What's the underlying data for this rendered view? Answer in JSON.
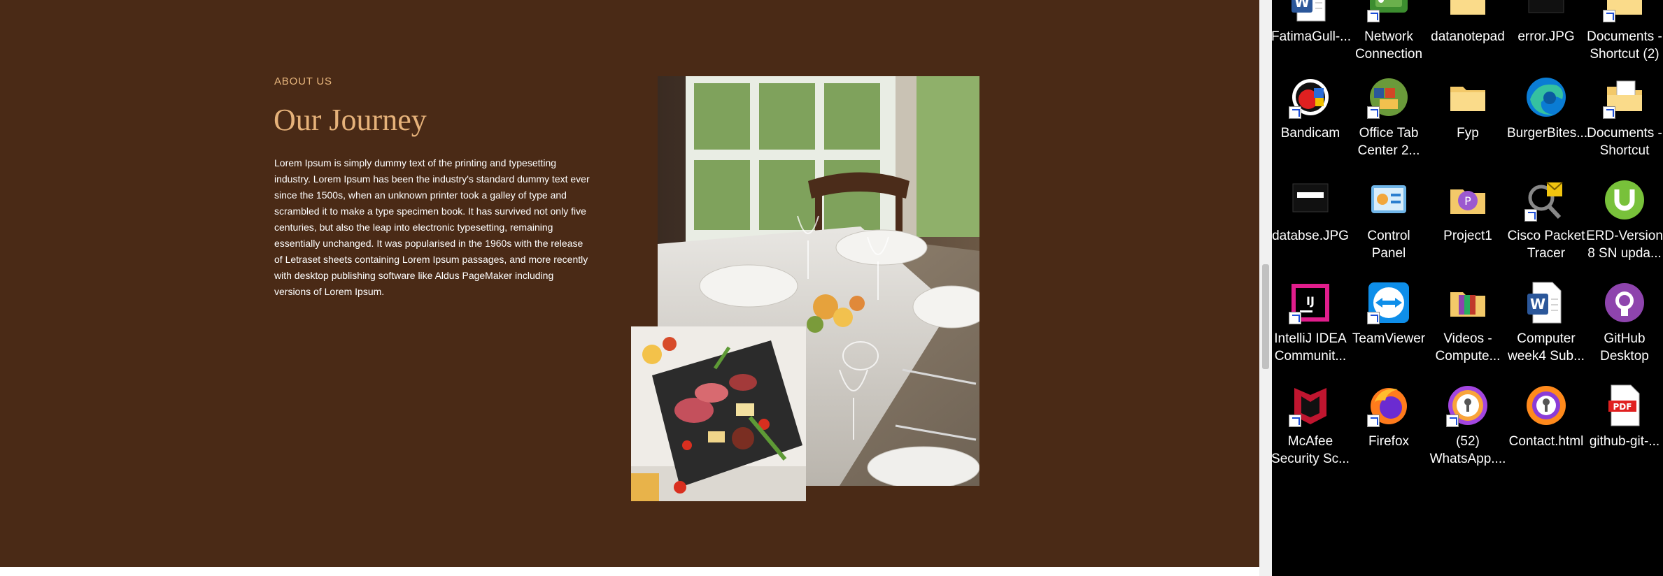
{
  "about": {
    "eyebrow": "ABOUT US",
    "title": "Our Journey",
    "body": "Lorem Ipsum is simply dummy text of the printing and typesetting industry. Lorem Ipsum has been the industry's standard dummy text ever since the 1500s, when an unknown printer took a galley of type and scrambled it to make a type specimen book. It has survived not only five centuries, but also the leap into electronic typesetting, remaining essentially unchanged. It was popularised in the 1960s with the release of Letraset sheets containing Lorem Ipsum passages, and more recently with desktop publishing software like Aldus PageMaker including versions of Lorem Ipsum."
  },
  "colors": {
    "section_bg": "#4a2a16",
    "accent": "#e6b27a"
  },
  "desktop": {
    "icons": [
      {
        "label": "FatimaGull-...",
        "icon": "word-document-icon"
      },
      {
        "label": "Network Connection",
        "icon": "network-connection-icon"
      },
      {
        "label": "datanotepad",
        "icon": "folder-icon"
      },
      {
        "label": "error.JPG",
        "icon": "image-file-icon"
      },
      {
        "label": "Documents - Shortcut (2)",
        "icon": "folder-shortcut-icon"
      },
      {
        "label": "Bandicam",
        "icon": "bandicam-icon"
      },
      {
        "label": "Office Tab Center 2...",
        "icon": "office-tab-icon"
      },
      {
        "label": "Fyp",
        "icon": "folder-icon"
      },
      {
        "label": "BurgerBites...",
        "icon": "edge-icon"
      },
      {
        "label": "Documents - Shortcut",
        "icon": "folder-shortcut-icon"
      },
      {
        "label": "databse.JPG",
        "icon": "image-file-icon"
      },
      {
        "label": "Control Panel",
        "icon": "control-panel-icon"
      },
      {
        "label": "Project1",
        "icon": "project-icon"
      },
      {
        "label": "Cisco Packet Tracer",
        "icon": "cisco-packet-tracer-icon"
      },
      {
        "label": "ERD-Version 8 SN upda...",
        "icon": "utorrent-icon"
      },
      {
        "label": "IntelliJ IDEA Communit...",
        "icon": "intellij-icon"
      },
      {
        "label": "TeamViewer",
        "icon": "teamviewer-icon"
      },
      {
        "label": "Videos - Compute...",
        "icon": "winrar-icon"
      },
      {
        "label": "Computer week4 Sub...",
        "icon": "word-document-icon"
      },
      {
        "label": "GitHub Desktop",
        "icon": "github-desktop-icon"
      },
      {
        "label": "McAfee Security Sc...",
        "icon": "mcafee-icon"
      },
      {
        "label": "Firefox",
        "icon": "firefox-icon"
      },
      {
        "label": "(52) WhatsApp....",
        "icon": "whatsapp-web-icon"
      },
      {
        "label": "Contact.html",
        "icon": "html-file-icon"
      },
      {
        "label": "github-git-...",
        "icon": "pdf-file-icon"
      }
    ]
  }
}
